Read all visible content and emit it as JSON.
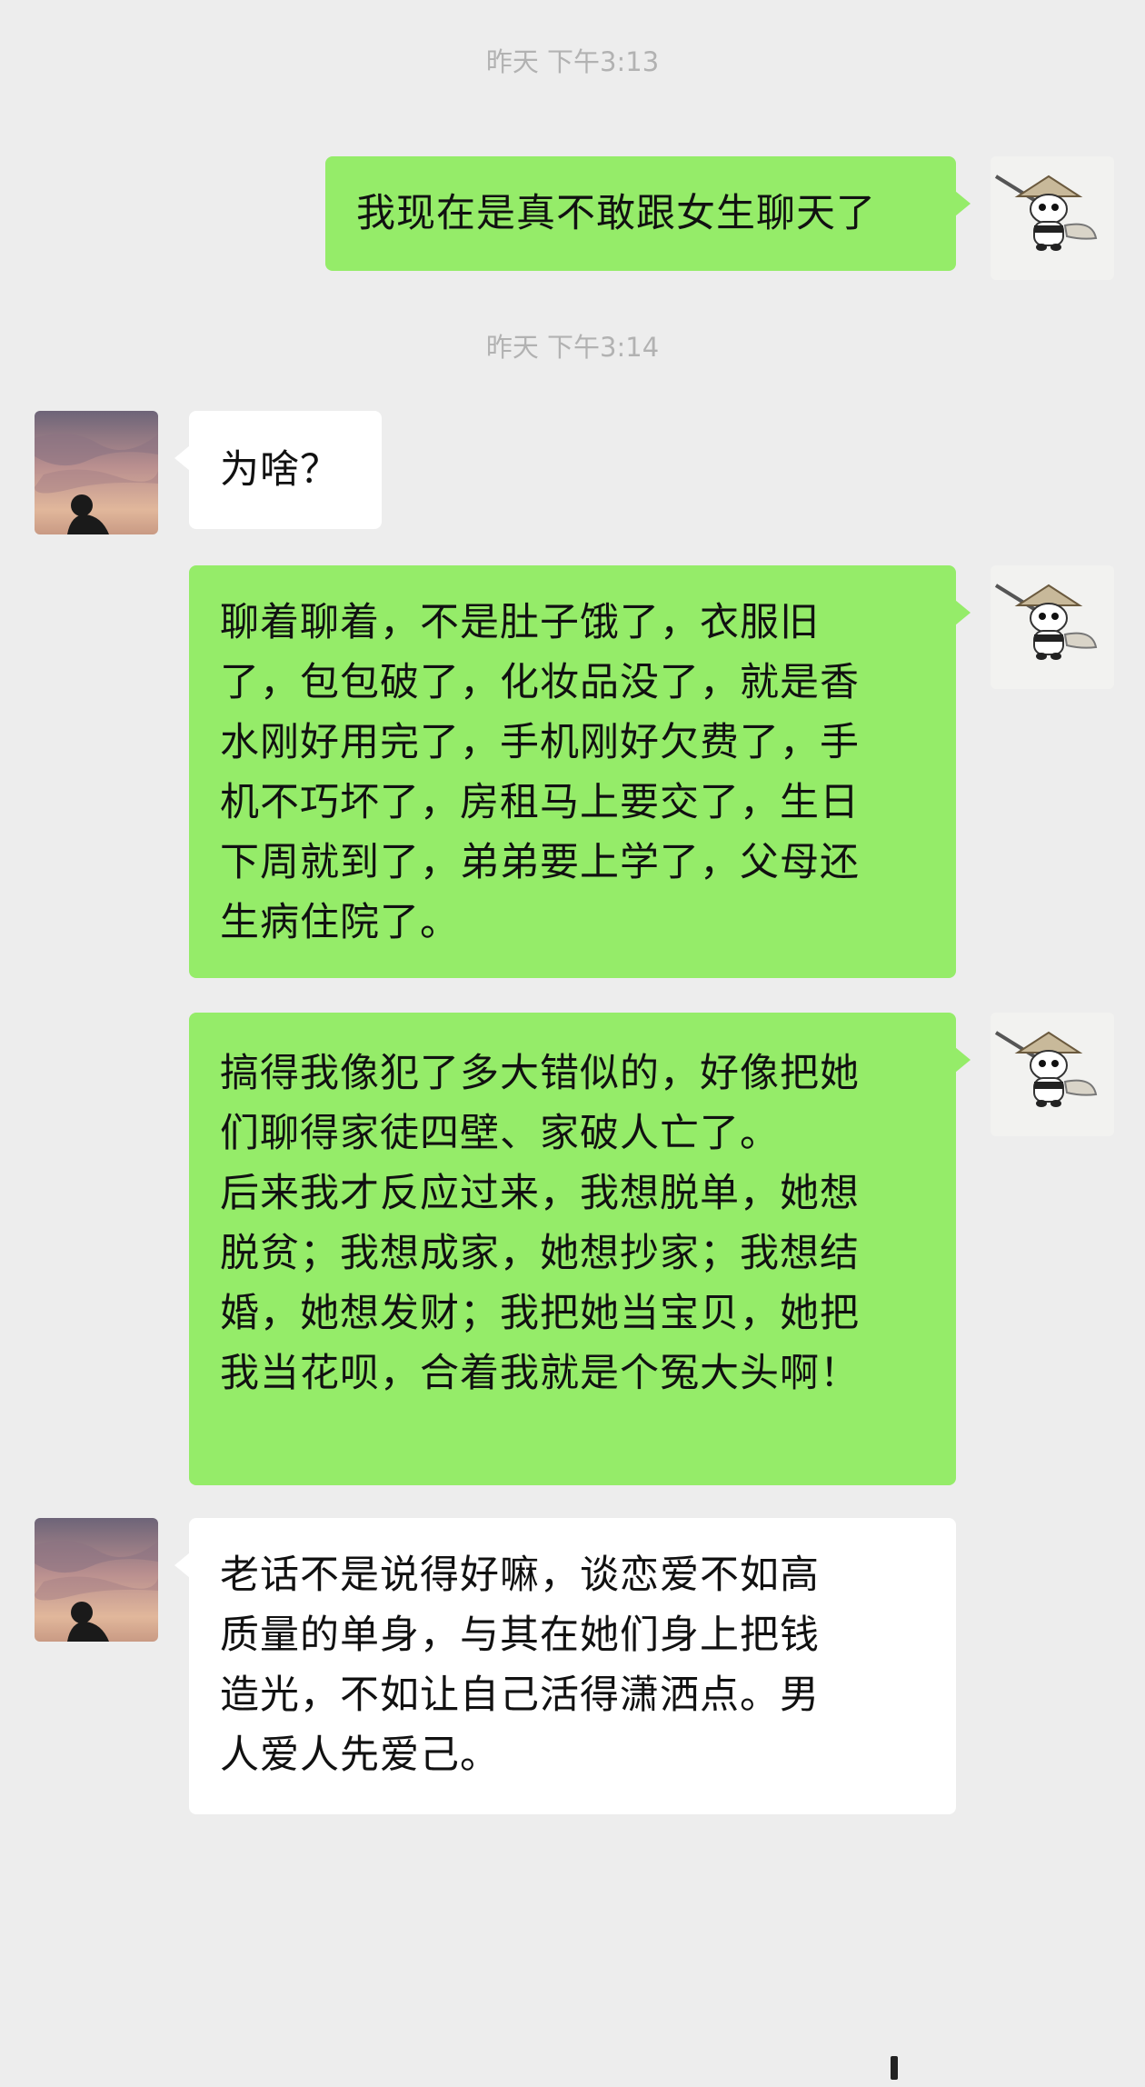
{
  "timestamps": [
    "昨天 下午3:13",
    "昨天 下午3:14"
  ],
  "messages": [
    {
      "from": "me",
      "text": "我现在是真不敢跟女生聊天了"
    },
    {
      "from": "them",
      "text": "为啥？"
    },
    {
      "from": "me",
      "text": "聊着聊着，不是肚子饿了，衣服旧\n了，包包破了，化妆品没了，就是香\n水刚好用完了，手机刚好欠费了，手\n机不巧坏了，房租马上要交了，生日\n下周就到了，弟弟要上学了，父母还\n生病住院了。"
    },
    {
      "from": "me",
      "text": "搞得我像犯了多大错似的，好像把她\n们聊得家徒四壁、家破人亡了。\n后来我才反应过来，我想脱单，她想\n脱贫；我想成家，她想抄家；我想结\n婚，她想发财；我把她当宝贝，她把\n我当花呗，合着我就是个冤大头啊！"
    },
    {
      "from": "them",
      "text": "老话不是说得好嘛，谈恋爱不如高\n质量的单身，与其在她们身上把钱\n造光，不如让自己活得潇洒点。男\n人爱人先爱己。"
    }
  ],
  "avatars": {
    "me": "panda-swordsman-avatar",
    "them": "sunset-silhouette-avatar"
  },
  "colors": {
    "background": "#ededed",
    "my_bubble": "#95ec69",
    "their_bubble": "#ffffff",
    "timestamp": "#b2b2b2"
  }
}
